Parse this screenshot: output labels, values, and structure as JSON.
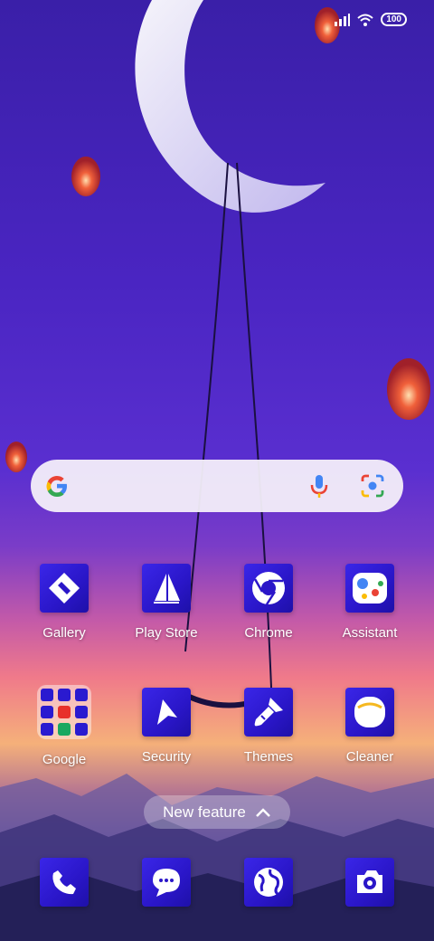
{
  "status_bar": {
    "battery": "100"
  },
  "search_bar": {
    "icons": [
      "google-logo",
      "microphone",
      "google-lens"
    ]
  },
  "apps_row1": [
    {
      "label": "Gallery",
      "icon": "gallery-icon"
    },
    {
      "label": "Play Store",
      "icon": "play-store-icon"
    },
    {
      "label": "Chrome",
      "icon": "chrome-icon"
    },
    {
      "label": "Assistant",
      "icon": "assistant-icon"
    }
  ],
  "apps_row2": [
    {
      "label": "Google",
      "icon": "google-folder"
    },
    {
      "label": "Security",
      "icon": "security-icon"
    },
    {
      "label": "Themes",
      "icon": "themes-icon"
    },
    {
      "label": "Cleaner",
      "icon": "cleaner-icon"
    }
  ],
  "new_feature": {
    "label": "New feature"
  },
  "dock": [
    "phone-icon",
    "messages-icon",
    "browser-icon",
    "camera-icon"
  ]
}
